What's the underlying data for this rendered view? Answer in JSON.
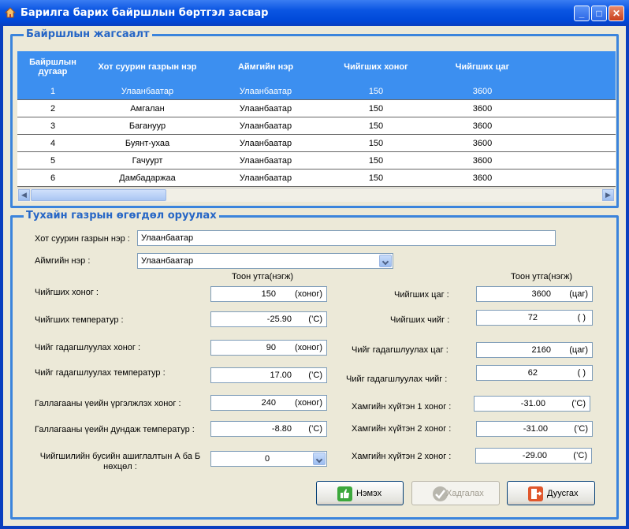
{
  "window": {
    "title": "Барилга барих байршлын бөртгэл засвар"
  },
  "location_group": {
    "legend": "Байршлын жагсаалт",
    "columns": [
      "Байршлын дугаар",
      "Хот суурин газрын нэр",
      "Аймгийн нэр",
      "Чийгших хоног",
      "Чийгших цаг"
    ],
    "rows": [
      [
        "1",
        "Улаанбаатар",
        "Улаанбаатар",
        "150",
        "3600"
      ],
      [
        "2",
        "Амгалан",
        "Улаанбаатар",
        "150",
        "3600"
      ],
      [
        "3",
        "Багануур",
        "Улаанбаатар",
        "150",
        "3600"
      ],
      [
        "4",
        "Буянт-ухаа",
        "Улаанбаатар",
        "150",
        "3600"
      ],
      [
        "5",
        "Гачуурт",
        "Улаанбаатар",
        "150",
        "3600"
      ],
      [
        "6",
        "Дамбадаржаа",
        "Улаанбаатар",
        "150",
        "3600"
      ]
    ],
    "selected_row": 0
  },
  "input_group": {
    "legend": "Тухайн газрын өгөгдөл оруулах",
    "city_label": "Хот суурин газрын нэр :",
    "city_value": "Улаанбаатар",
    "province_label": "Аймгийн нэр :",
    "province_value": "Улаанбаатар",
    "value_header_left": "Тоон утга(нэгж)",
    "value_header_right": "Тоон утга(нэгж)",
    "left_fields": [
      {
        "label": "Чийгших хоног :",
        "value": "150",
        "unit": "(хоног)"
      },
      {
        "label": "Чийгших температур :",
        "value": "-25.90",
        "unit": "(’C)"
      },
      {
        "label": "Чийг гадагшлуулах хоног :",
        "value": "90",
        "unit": "(хоног)"
      },
      {
        "label": "Чийг гадагшлуулах температур :",
        "value": "17.00",
        "unit": "(’C)"
      },
      {
        "label": "Галлагааны үеийн үргэлжлэх хоног :",
        "value": "240",
        "unit": "(хоног)"
      },
      {
        "label": "Галлагааны үеийн дундаж температур :",
        "value": "-8.80",
        "unit": "(’C)"
      }
    ],
    "right_fields": [
      {
        "label": "Чийгших цаг :",
        "value": "3600",
        "unit": "(цаг)"
      },
      {
        "label": "Чийгших чийг :",
        "value": "72",
        "unit": "(   )"
      },
      {
        "label": "Чийг гадагшлуулах цаг :",
        "value": "2160",
        "unit": "(цаг)"
      },
      {
        "label": "Чийг гадагшлуулах чийг :",
        "value": "62",
        "unit": "(   )"
      },
      {
        "label": "Хамгийн хүйтэн 1 хоног :",
        "value": "-31.00",
        "unit": "(’C)"
      },
      {
        "label": "Хамгийн хүйтэн 2 хоног :",
        "value": "-31.00",
        "unit": "(’C)"
      },
      {
        "label": "Хамгийн хүйтэн 2 хоног :",
        "value": "-29.00",
        "unit": "(’C)"
      }
    ],
    "condition_label_1": "Чийгшилийн бусийн ашиглалтын А ба Б",
    "condition_label_2": "нөхцөл :",
    "condition_value": "0"
  },
  "buttons": {
    "add": "Нэмэх",
    "save": "Хадгалах",
    "delete": "Дуусгах"
  },
  "colors": {
    "accent": "#3c8ff0",
    "titlebar": "#0a55e2",
    "group_border": "#3b84dc"
  }
}
